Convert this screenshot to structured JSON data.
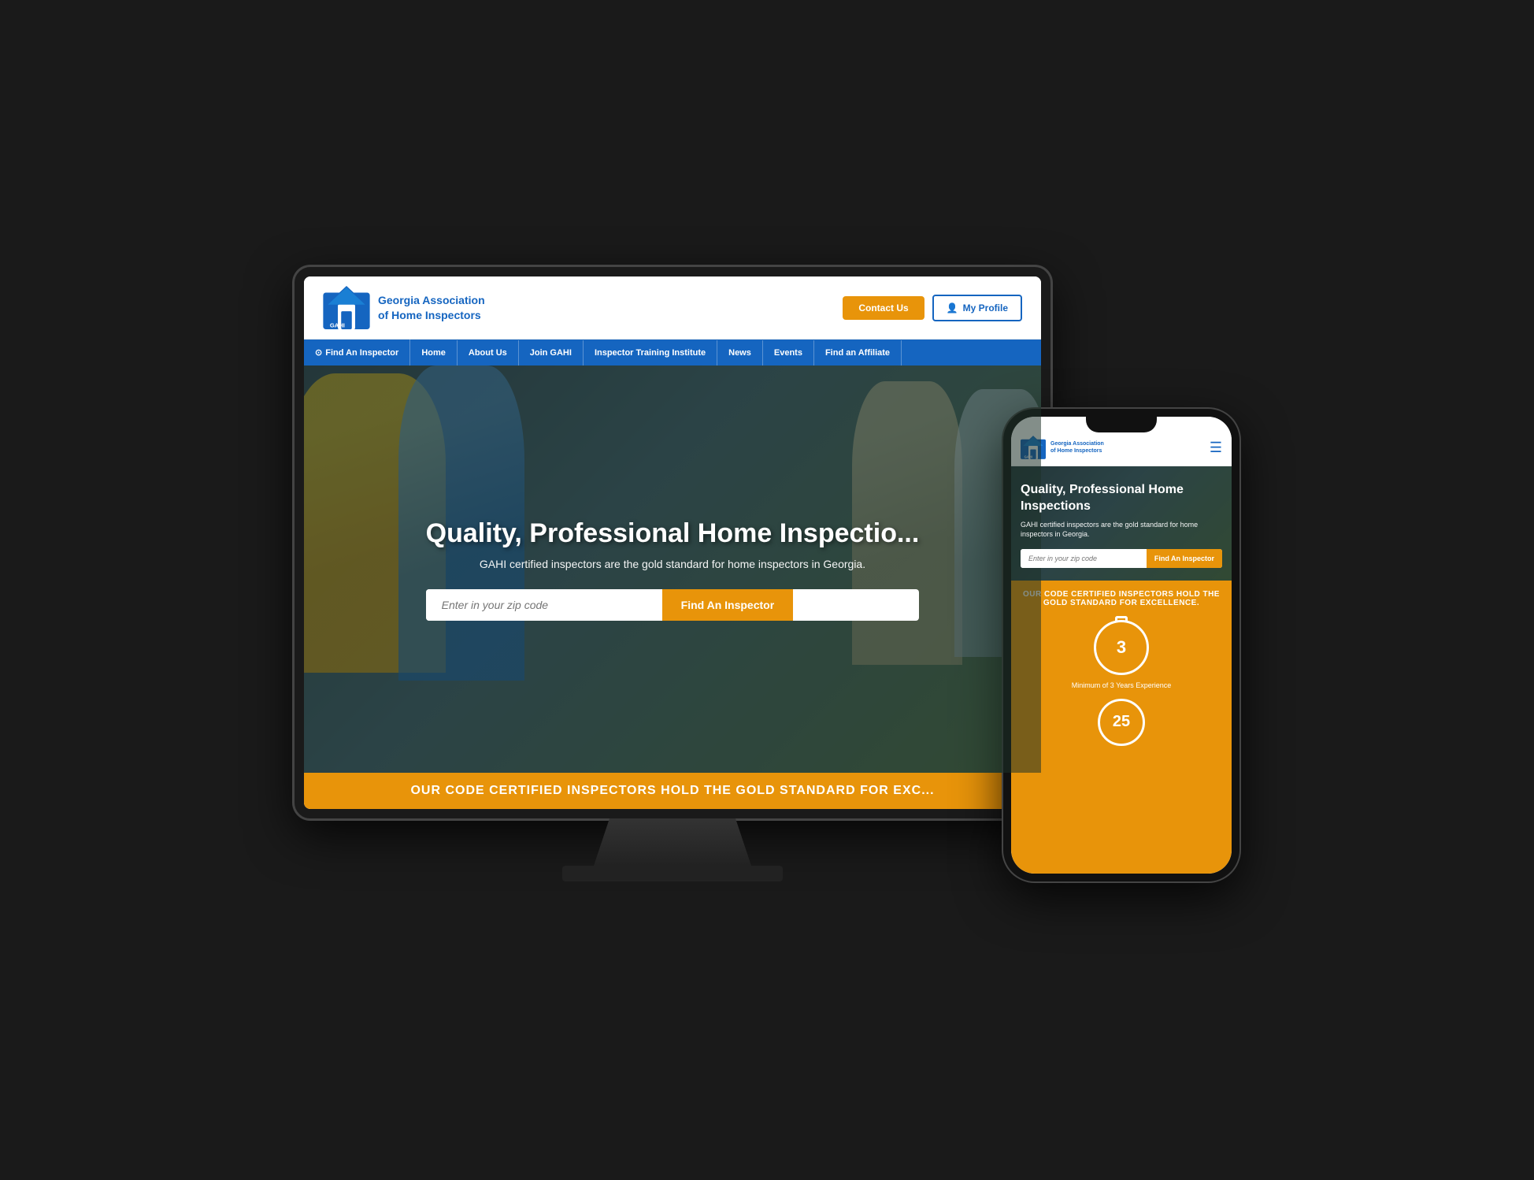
{
  "site": {
    "org_name_line1": "Georgia Association",
    "org_name_line2": "of Home Inspectors",
    "acronym": "GAHI"
  },
  "header": {
    "contact_label": "Contact Us",
    "profile_label": "My Profile"
  },
  "nav": {
    "items": [
      {
        "label": "Find An Inspector",
        "icon": "search"
      },
      {
        "label": "Home"
      },
      {
        "label": "About Us"
      },
      {
        "label": "Join GAHI"
      },
      {
        "label": "Inspector Training Institute"
      },
      {
        "label": "News"
      },
      {
        "label": "Events"
      },
      {
        "label": "Find an Affiliate"
      }
    ]
  },
  "hero": {
    "title": "Quality, Professional Home Inspectio...",
    "title_full": "Quality, Professional Home Inspections",
    "subtitle": "GAHI certified inspectors are the gold standard for home inspectors in Georgia.",
    "zip_placeholder": "Enter in your zip code",
    "find_btn": "Find An Inspector"
  },
  "banner": {
    "text": "OUR CODE CERTIFIED INSPECTORS HOLD THE GOLD STANDARD FOR EXC..."
  },
  "mobile": {
    "hero_title": "Quality, Professional Home Inspections",
    "hero_subtitle": "GAHI certified inspectors are the gold standard for home inspectors in Georgia.",
    "zip_placeholder": "Enter in your zip code",
    "find_btn": "Find An Inspector",
    "orange_title": "OUR CODE CERTIFIED INSPECTORS HOLD THE GOLD STANDARD FOR EXCELLENCE.",
    "badge1_number": "3",
    "badge1_label": "Minimum of 3 Years Experience",
    "badge2_number": "25"
  }
}
